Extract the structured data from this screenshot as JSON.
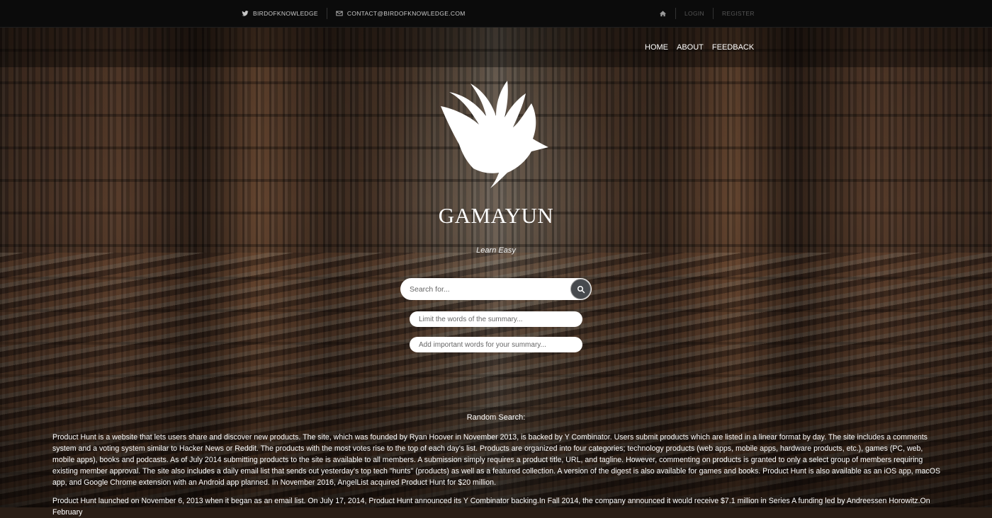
{
  "topbar": {
    "twitter_label": "BIRDOFKNOWLEDGE",
    "email_label": "CONTACT@BIRDOFKNOWLEDGE.COM",
    "icons": {
      "twitter": "twitter-icon",
      "email": "envelope-icon",
      "home": "home-icon"
    },
    "login_label": "LOGIN",
    "register_label": "REGISTER"
  },
  "nav": {
    "items": [
      {
        "label": "HOME"
      },
      {
        "label": "ABOUT"
      },
      {
        "label": "FEEDBACK"
      }
    ]
  },
  "hero": {
    "logo_icon": "bird-icon",
    "brand": "GAMAYUN",
    "tagline": "Learn Easy"
  },
  "search": {
    "placeholder": "Search for...",
    "button_icon": "magnifier-icon",
    "limit_placeholder": "Limit the words of the summary...",
    "keywords_placeholder": "Add important words for your summary..."
  },
  "random": {
    "heading": "Random Search:",
    "paragraphs": [
      "Product Hunt is a website that lets users share and discover new products. The site, which was founded by Ryan Hoover in November 2013, is backed by Y Combinator. Users submit products which are listed in a linear format by day. The site includes a comments system and a voting system similar to Hacker News or Reddit. The products with the most votes rise to the top of each day's list. Products are organized into four categories; technology products (web apps, mobile apps, hardware products, etc.), games (PC, web, mobile apps), books and podcasts. As of July 2014 submitting products to the site is available to all members. A submission simply requires a product title, URL, and tagline. However, commenting on products is granted to only a select group of members requiring existing member approval. The site also includes a daily email list that sends out yesterday's top tech \"hunts\" (products) as well as a featured collection. A version of the digest is also available for games and books. Product Hunt is also available as an iOS app, macOS app, and Google Chrome extension with an Android app planned. In November 2016, AngelList acquired Product Hunt for $20 million.",
      "Product Hunt launched on November 6, 2013 when it began as an email list. On July 17, 2014, Product Hunt announced its Y Combinator backing.In Fall 2014, the company announced it would receive $7.1 million in Series A funding led by Andreessen Horowitz.On February"
    ]
  },
  "colors": {
    "topbar_bg": "#0b0b0b",
    "search_button": "#474a4e",
    "text": "#ffffff"
  }
}
